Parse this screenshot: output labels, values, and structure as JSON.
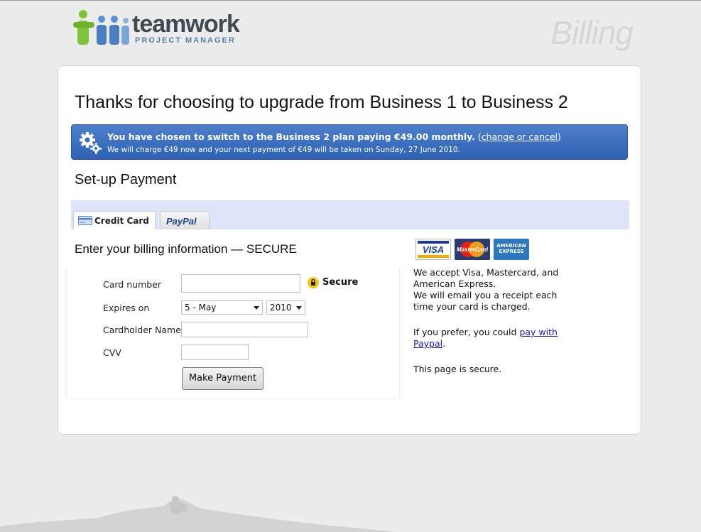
{
  "header": {
    "logo_word": "teamwork",
    "logo_sub": "PROJECT MANAGER",
    "page_heading": "Billing"
  },
  "main": {
    "title": "Thanks for choosing to upgrade from Business 1 to Business 2",
    "notice": {
      "line1_bold": "You have chosen to switch to the Business 2 plan paying €49.00 monthly.",
      "paren_open": " (",
      "link": "change or cancel",
      "paren_close": ")",
      "line2": "We will charge €49 now and your next payment of €49 will be taken on Sunday, 27 June 2010."
    },
    "section_title": "Set-up Payment",
    "tabs": [
      {
        "label": "Credit Card",
        "active": true
      },
      {
        "label": "PayPal",
        "active": false
      }
    ],
    "billing_heading": "Enter your billing information — SECURE",
    "form": {
      "card_number_label": "Card number",
      "card_number_value": "",
      "secure_label": "Secure",
      "expires_label": "Expires on",
      "month_value": "5 - May",
      "year_value": "2010",
      "cardholder_label": "Cardholder Name",
      "cardholder_value": "",
      "cvv_label": "CVV",
      "cvv_value": "",
      "submit_label": "Make Payment"
    },
    "sidebar": {
      "accepted_cards": [
        "VISA",
        "MasterCard",
        "AMERICAN EXPRESS"
      ],
      "accept_line1": "We accept Visa, Mastercard, and",
      "accept_line2": "American Express.",
      "receipt_line1": "We will email you a receipt each",
      "receipt_line2": "time your card is charged.",
      "prefer_prefix": "If you prefer, you could ",
      "paypal_link_1": "pay with",
      "paypal_link_2": "Paypal",
      "prefer_suffix": ".",
      "secure_note": "This page is secure."
    }
  },
  "colors": {
    "notice_bg": "#2f62b5",
    "tabbar_bg": "#dfe5f8",
    "link": "#1a1aa6"
  }
}
